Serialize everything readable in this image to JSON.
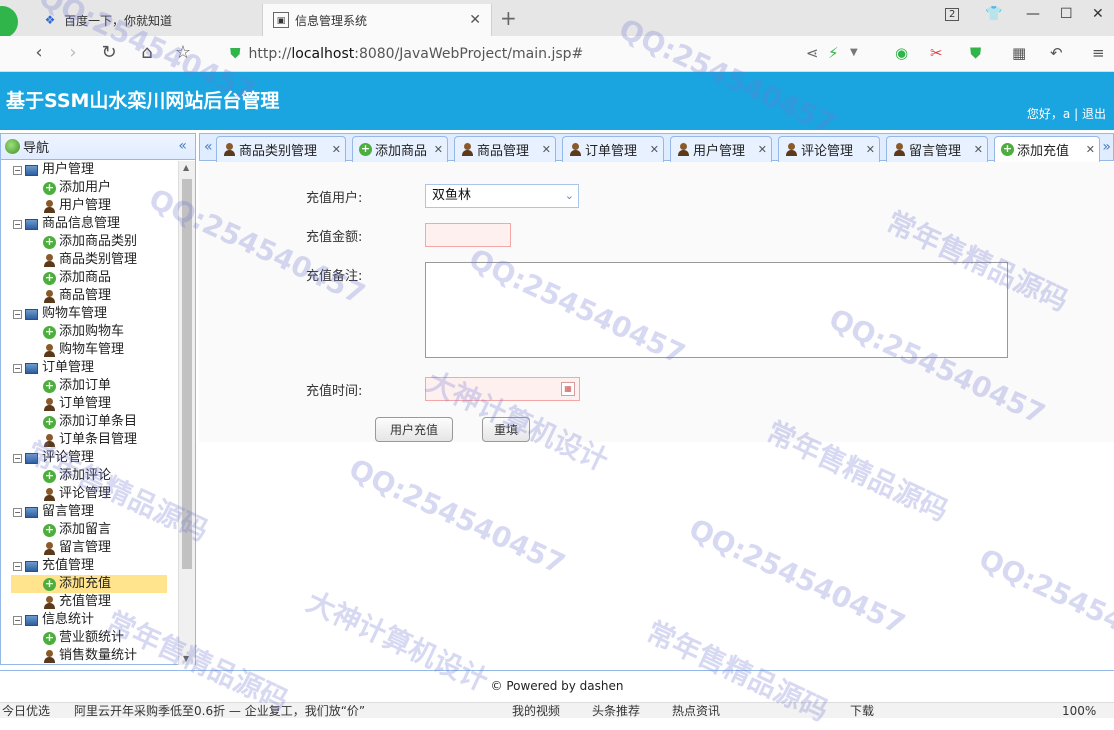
{
  "browser": {
    "tabs": [
      {
        "label": "百度一下，你就知道",
        "icon": "paw-icon"
      },
      {
        "label": "信息管理系统",
        "icon": "image-icon"
      }
    ],
    "tab_count": "2",
    "url_prefix": "http://",
    "url_host": "localhost",
    "url_rest": ":8080/JavaWebProject/main.jsp#"
  },
  "app": {
    "title": "基于SSM山水栾川网站后台管理",
    "greeting": "您好，a",
    "separator": "|",
    "logout": "退出"
  },
  "nav": {
    "title": "导航",
    "groups": [
      {
        "label": "用户管理",
        "items": [
          {
            "label": "添加用户",
            "type": "add"
          },
          {
            "label": "用户管理",
            "type": "user"
          }
        ]
      },
      {
        "label": "商品信息管理",
        "items": [
          {
            "label": "添加商品类别",
            "type": "add"
          },
          {
            "label": "商品类别管理",
            "type": "user"
          },
          {
            "label": "添加商品",
            "type": "add"
          },
          {
            "label": "商品管理",
            "type": "user"
          }
        ]
      },
      {
        "label": "购物车管理",
        "items": [
          {
            "label": "添加购物车",
            "type": "add"
          },
          {
            "label": "购物车管理",
            "type": "user"
          }
        ]
      },
      {
        "label": "订单管理",
        "items": [
          {
            "label": "添加订单",
            "type": "add"
          },
          {
            "label": "订单管理",
            "type": "user"
          },
          {
            "label": "添加订单条目",
            "type": "add"
          },
          {
            "label": "订单条目管理",
            "type": "user"
          }
        ]
      },
      {
        "label": "评论管理",
        "items": [
          {
            "label": "添加评论",
            "type": "add"
          },
          {
            "label": "评论管理",
            "type": "user"
          }
        ]
      },
      {
        "label": "留言管理",
        "items": [
          {
            "label": "添加留言",
            "type": "add"
          },
          {
            "label": "留言管理",
            "type": "user"
          }
        ]
      },
      {
        "label": "充值管理",
        "items": [
          {
            "label": "添加充值",
            "type": "add",
            "selected": true
          },
          {
            "label": "充值管理",
            "type": "user"
          }
        ]
      },
      {
        "label": "信息统计",
        "items": [
          {
            "label": "营业额统计",
            "type": "add"
          },
          {
            "label": "销售数量统计",
            "type": "user"
          }
        ]
      }
    ]
  },
  "tabs": [
    {
      "label": "商品类别管理",
      "icon": "user"
    },
    {
      "label": "添加商品",
      "icon": "add"
    },
    {
      "label": "商品管理",
      "icon": "user"
    },
    {
      "label": "订单管理",
      "icon": "user"
    },
    {
      "label": "用户管理",
      "icon": "user"
    },
    {
      "label": "评论管理",
      "icon": "user"
    },
    {
      "label": "留言管理",
      "icon": "user"
    },
    {
      "label": "添加充值",
      "icon": "add",
      "active": true
    }
  ],
  "form": {
    "user_label": "充值用户:",
    "user_value": "双鱼林",
    "amount_label": "充值金额:",
    "note_label": "充值备注:",
    "time_label": "充值时间:",
    "submit_label": "用户充值",
    "reset_label": "重填"
  },
  "footer": {
    "text": "© Powered by dashen"
  },
  "statusbar": {
    "left": "今日优选",
    "ad": "阿里云开年采购季低至0.6折 — 企业复工，我们放“价”",
    "video": "我的视频",
    "recommend": "头条推荐",
    "news": "热点资讯",
    "download": "下载",
    "zoom": "100%"
  },
  "watermarks": [
    "QQ:254540457",
    "大神计算机设计",
    "常年售精品源码"
  ]
}
